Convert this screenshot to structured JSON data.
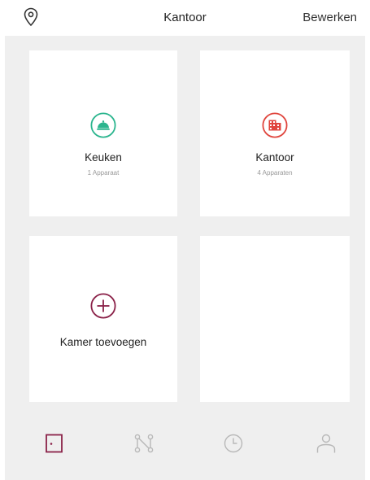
{
  "header": {
    "title": "Kantoor",
    "edit_label": "Bewerken",
    "location_icon": "location-pin-icon"
  },
  "rooms": [
    {
      "name": "Keuken",
      "count": "1 Apparaat",
      "icon": "cloche-icon",
      "color": "#2bb58e"
    },
    {
      "name": "Kantoor",
      "count": "4 Apparaten",
      "icon": "office-building-icon",
      "color": "#e0463e"
    }
  ],
  "add_room": {
    "label": "Kamer toevoegen",
    "icon": "plus-circle-icon",
    "color": "#8a2148"
  },
  "tabbar": {
    "tabs": [
      {
        "icon": "door-icon",
        "active": true
      },
      {
        "icon": "automation-icon",
        "active": false
      },
      {
        "icon": "clock-icon",
        "active": false
      },
      {
        "icon": "profile-icon",
        "active": false
      }
    ],
    "active_color": "#8a2148",
    "inactive_color": "#b8b8b8"
  }
}
